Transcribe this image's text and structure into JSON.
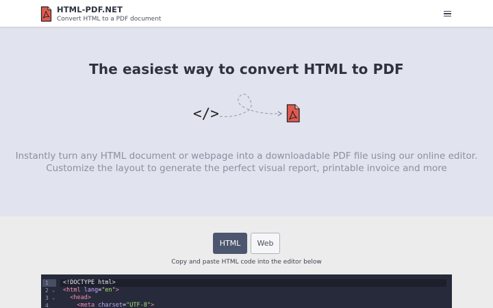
{
  "navbar": {
    "brand_name": "HTML-PDF.NET",
    "brand_tagline": "Convert HTML to a PDF document",
    "logo_icon": "pdf-file-icon",
    "menu_icon": "hamburger-menu-icon"
  },
  "hero": {
    "title": "The easiest way to convert HTML to PDF",
    "code_symbol": "</>",
    "desc_line1": "Instantly turn any HTML document or webpage into a downloadable PDF file using our online editor.",
    "desc_line2": "Customize the layout to generate the perfect visual report, printable invoice and more"
  },
  "tabs": {
    "html_label": "HTML",
    "web_label": "Web",
    "active": "HTML"
  },
  "hint": "Copy and paste HTML code into the editor below",
  "editor": {
    "lines": [
      {
        "num": "1",
        "fold": "",
        "parts": [
          "<!DOCTYPE html>"
        ]
      },
      {
        "num": "2",
        "fold": "⌄",
        "parts": [
          "<html",
          " lang",
          "=",
          "\"en\"",
          ">"
        ]
      },
      {
        "num": "3",
        "fold": "⌄",
        "parts": [
          "<head",
          ">"
        ]
      },
      {
        "num": "4",
        "fold": "",
        "parts": [
          "<meta",
          " charset",
          "=",
          "\"UTF-8\"",
          ">"
        ]
      }
    ]
  },
  "colors": {
    "hero_bg": "#e1e3ee",
    "active_tab": "#4d566f",
    "pdf_red": "#e05a4f",
    "editor_bg": "#272a3a"
  }
}
